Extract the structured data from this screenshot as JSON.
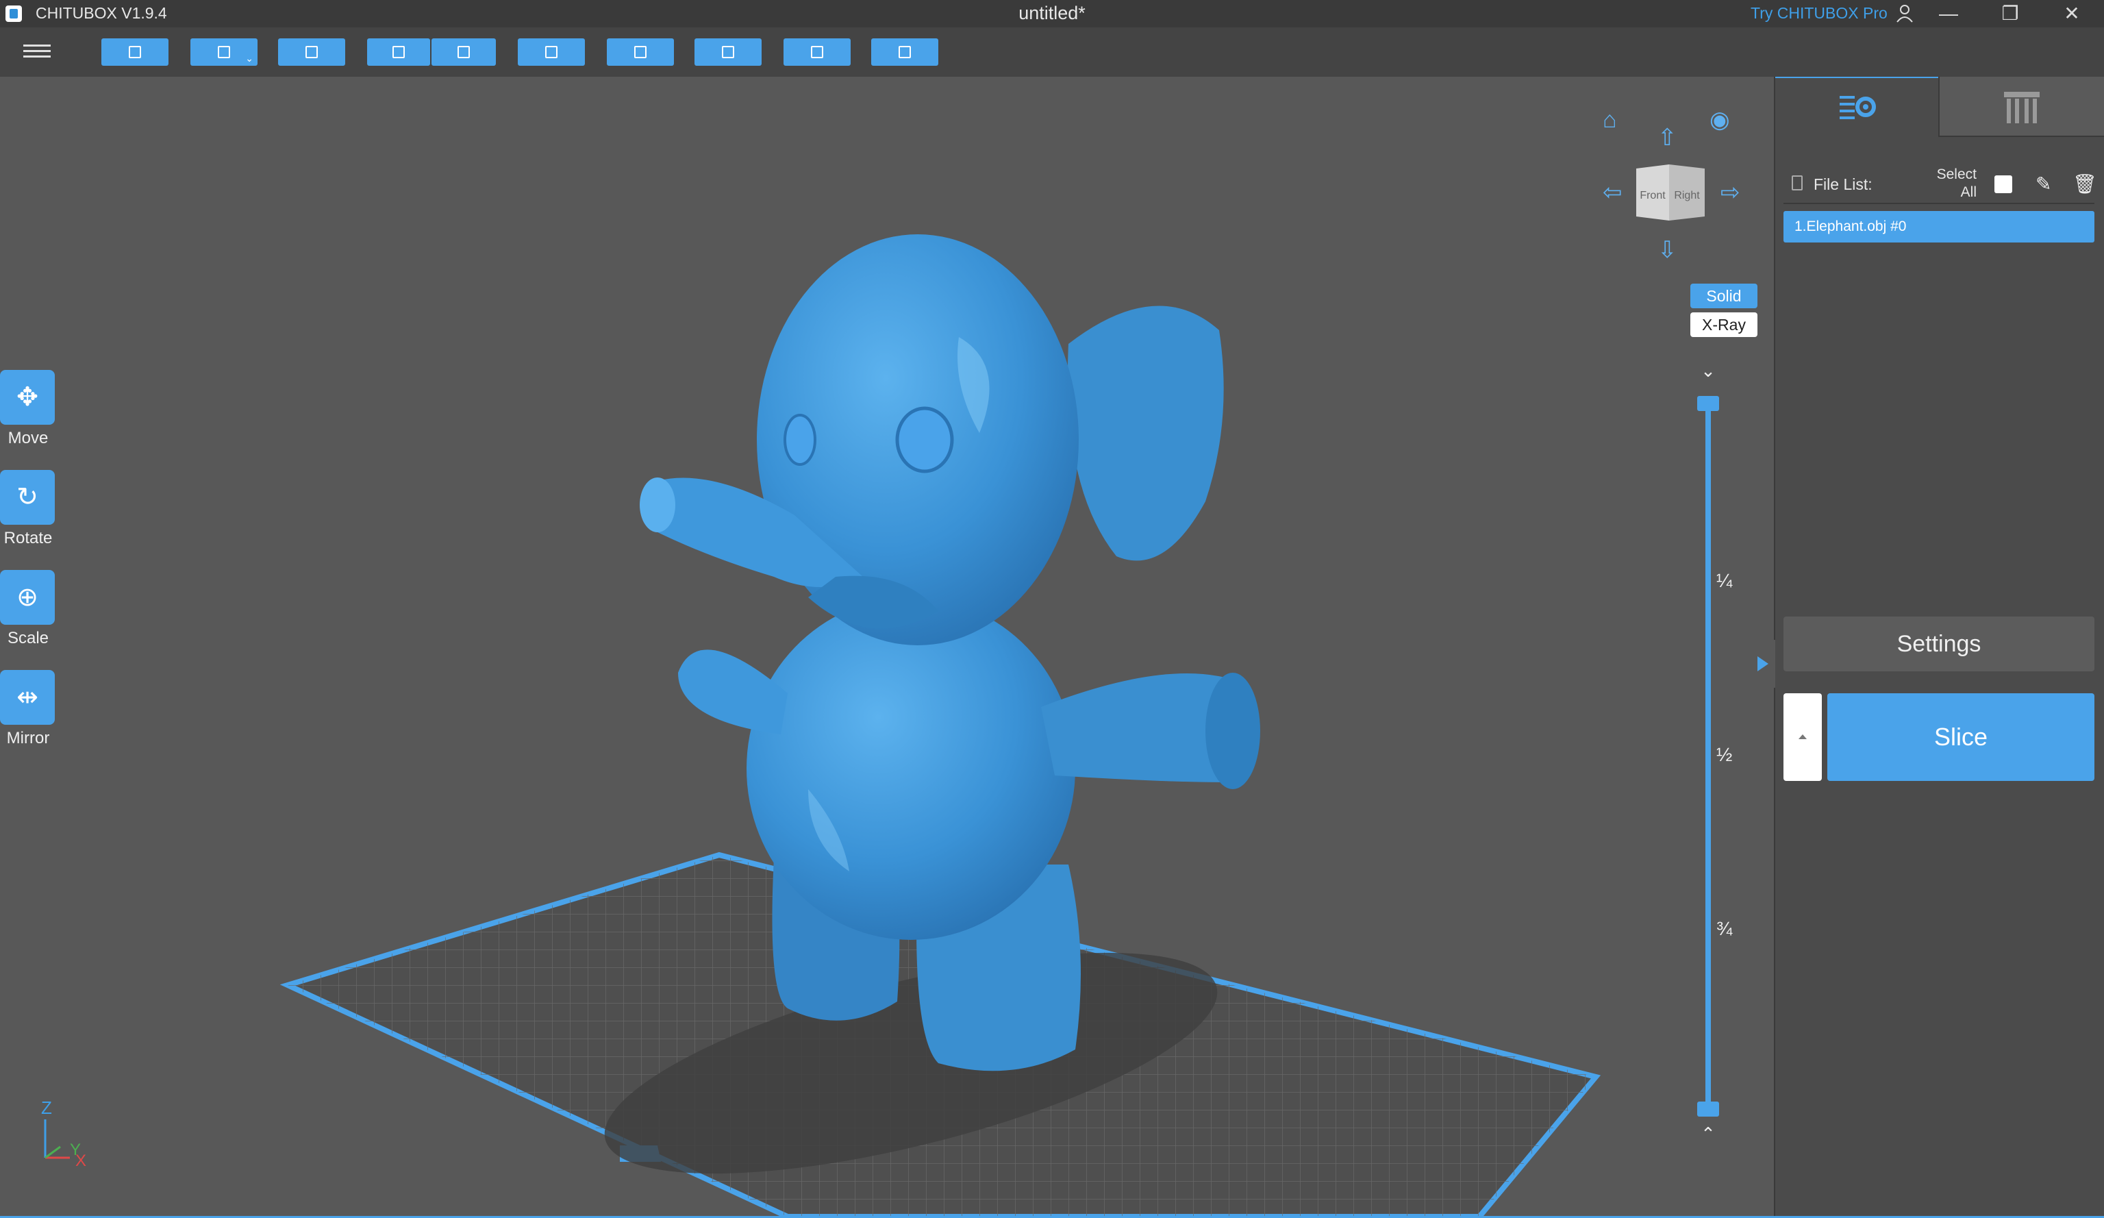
{
  "app": {
    "name": "CHITUBOX V1.9.4",
    "document_title": "untitled*",
    "try_pro": "Try CHITUBOX Pro"
  },
  "window_controls": {
    "minimize": "—",
    "restore": "❐",
    "close": "✕"
  },
  "toolbar": {
    "buttons": [
      "open-file",
      "save",
      "auto-layout",
      "undo",
      "redo",
      "file-info",
      "duplicate",
      "hollow",
      "hole",
      "export"
    ]
  },
  "tools": [
    {
      "label": "Move",
      "icon": "move-icon"
    },
    {
      "label": "Rotate",
      "icon": "rotate-icon"
    },
    {
      "label": "Scale",
      "icon": "scale-icon"
    },
    {
      "label": "Mirror",
      "icon": "mirror-icon"
    }
  ],
  "view_cube": {
    "front": "Front",
    "right": "Right"
  },
  "render_mode": {
    "solid": "Solid",
    "xray": "X-Ray",
    "selected": "Solid"
  },
  "layer_slider": {
    "marks": [
      "¼",
      "½",
      "¾"
    ]
  },
  "axis": {
    "z": "Z",
    "y": "Y",
    "x": "X"
  },
  "panel": {
    "file_list_label": "File List:",
    "select_all": "Select All",
    "files": [
      "1.Elephant.obj #0"
    ],
    "settings_label": "Settings",
    "slice_label": "Slice"
  },
  "colors": {
    "accent": "#4aa3ea",
    "model": "#3a8fd0",
    "background": "#585858",
    "titlebar": "#3a3a3a"
  }
}
